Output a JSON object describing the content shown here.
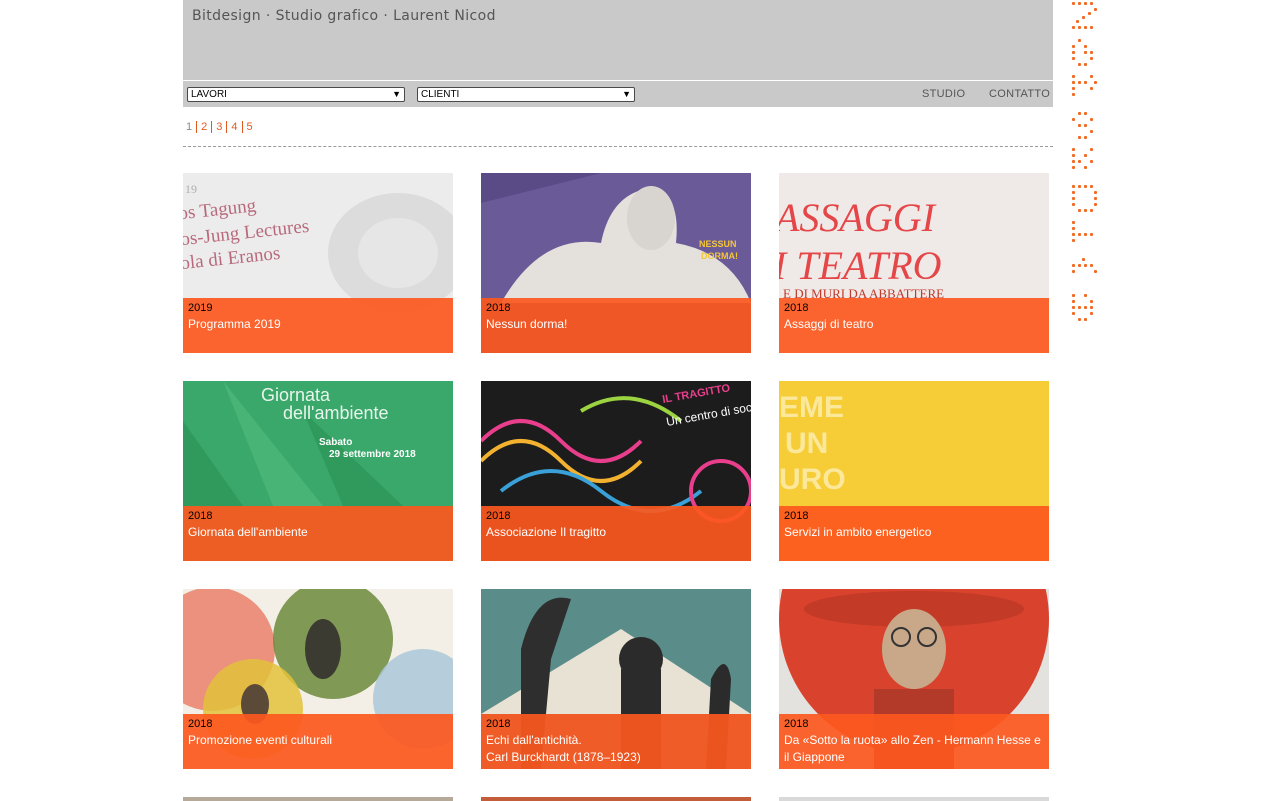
{
  "site": {
    "title": "Bitdesign · Studio grafico · Laurent Nicod"
  },
  "nav": {
    "lavori_select": "LAVORI",
    "clienti_select": "CLIENTI",
    "studio": "STUDIO",
    "contatto": "CONTATTO"
  },
  "pagination": [
    "1",
    "2",
    "3",
    "4",
    "5"
  ],
  "colors": {
    "accent": "#fd581e",
    "header_bg": "#c9c9c9",
    "link": "#e05a20"
  },
  "projects": [
    {
      "year": "2019",
      "title": "Programma 2019",
      "image_text": "os Tagung\nos-Jung Lectures\nola di Eranos"
    },
    {
      "year": "2018",
      "title": "Nessun dorma!",
      "image_text": "NESSUN DORMA!"
    },
    {
      "year": "2018",
      "title": "Assaggi di teatro",
      "image_text": "ASSAGGI\nI TEATRO"
    },
    {
      "year": "2018",
      "title": "Giornata dell'ambiente",
      "image_text": "Giornata\ndell'ambiente"
    },
    {
      "year": "2018",
      "title": "Associazione Il tragitto",
      "image_text": "IL TRAGITTO"
    },
    {
      "year": "2018",
      "title": "Servizi in ambito energetico",
      "image_text": "EME\nUN\nURO"
    },
    {
      "year": "2018",
      "title": "Promozione eventi culturali",
      "image_text": ""
    },
    {
      "year": "2018",
      "title": "Echi dall'antichità.",
      "title2": "Carl Burckhardt (1878–1923)",
      "image_text": ""
    },
    {
      "year": "2018",
      "title": "Da «Sotto la ruota» allo Zen - Hermann Hesse e",
      "title2": "il Giappone",
      "image_text": ""
    }
  ]
}
